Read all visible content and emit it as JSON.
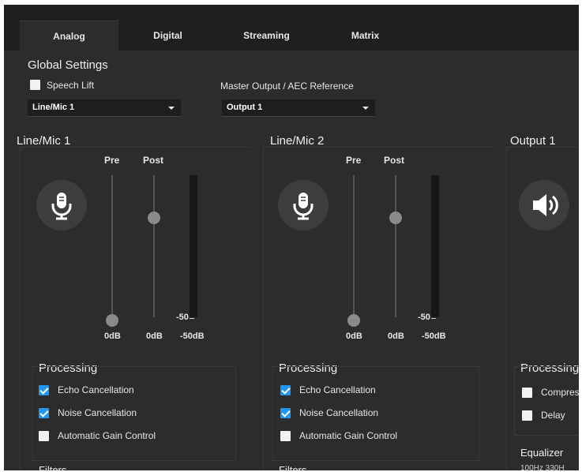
{
  "tabs": [
    {
      "label": "Analog",
      "active": true
    },
    {
      "label": "Digital",
      "active": false
    },
    {
      "label": "Streaming",
      "active": false
    },
    {
      "label": "Matrix",
      "active": false
    }
  ],
  "global": {
    "title": "Global Settings",
    "speech_lift": {
      "label": "Speech Lift",
      "checked": false
    },
    "input_select": {
      "value": "Line/Mic 1"
    },
    "master_output": {
      "label": "Master Output / AEC Reference",
      "value": "Output 1"
    }
  },
  "channels": [
    {
      "title": "Line/Mic 1",
      "icon": "microphone-icon",
      "fader_labels": {
        "pre": "Pre",
        "post": "Post"
      },
      "meter_tick": "-50",
      "db": {
        "pre": "0dB",
        "post": "0dB",
        "meter": "-50dB"
      },
      "processing": {
        "title": "Processing",
        "items": [
          {
            "label": "Echo Cancellation",
            "checked": true
          },
          {
            "label": "Noise Cancellation",
            "checked": true
          },
          {
            "label": "Automatic Gain Control",
            "checked": false
          }
        ]
      },
      "filters_title": "Filters"
    },
    {
      "title": "Line/Mic 2",
      "icon": "microphone-icon",
      "fader_labels": {
        "pre": "Pre",
        "post": "Post"
      },
      "meter_tick": "-50",
      "db": {
        "pre": "0dB",
        "post": "0dB",
        "meter": "-50dB"
      },
      "processing": {
        "title": "Processing",
        "items": [
          {
            "label": "Echo Cancellation",
            "checked": true
          },
          {
            "label": "Noise Cancellation",
            "checked": true
          },
          {
            "label": "Automatic Gain Control",
            "checked": false
          }
        ]
      },
      "filters_title": "Filters"
    }
  ],
  "output": {
    "title": "Output 1",
    "icon": "speaker-icon",
    "processing": {
      "title": "Processing",
      "items": [
        {
          "label": "Compres",
          "checked": false
        },
        {
          "label": "Delay",
          "checked": false
        }
      ]
    },
    "equalizer_title": "Equalizer",
    "eq_bands": "100Hz  330H"
  },
  "colors": {
    "accent": "#2196f3",
    "background": "#2c2c2c",
    "tabbar": "#1f1f1f"
  }
}
